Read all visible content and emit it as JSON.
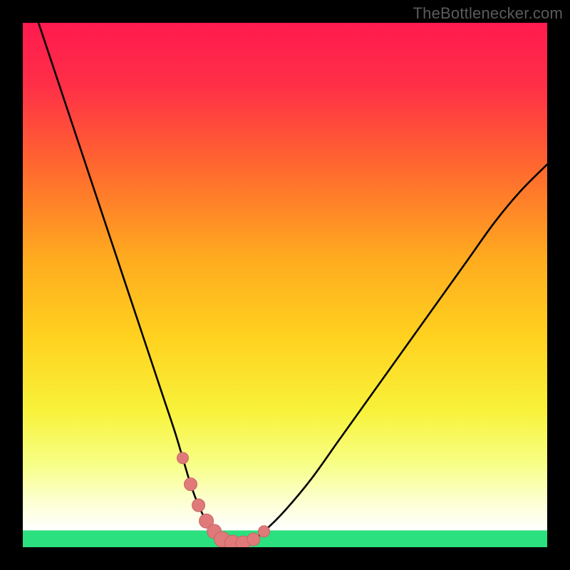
{
  "attribution": "TheBottlenecker.com",
  "colors": {
    "frame": "#000000",
    "attribution_text": "#5b5b5b",
    "curve_stroke": "#000000",
    "marker_fill": "#e07a7a",
    "marker_stroke": "#c86464",
    "green_band": "#2be07e",
    "gradient_top": "#ff1a4f",
    "gradient_mid_upper": "#ff7a2a",
    "gradient_mid": "#ffd21f",
    "gradient_mid_lower": "#f7ff55",
    "gradient_lower": "#fdffd0"
  },
  "chart_data": {
    "type": "line",
    "title": "",
    "xlabel": "",
    "ylabel": "",
    "xlim": [
      0,
      100
    ],
    "ylim": [
      0,
      100
    ],
    "grid": false,
    "series": [
      {
        "name": "bottleneck-curve",
        "x": [
          3,
          5,
          7,
          9,
          11,
          13,
          15,
          17,
          19,
          21,
          23,
          25,
          27,
          29,
          30.5,
          32,
          33.5,
          35,
          36.5,
          38,
          40,
          42,
          44,
          46,
          50,
          55,
          60,
          65,
          70,
          75,
          80,
          85,
          90,
          95,
          100
        ],
        "y": [
          100,
          94,
          88,
          82,
          76,
          70,
          64,
          58,
          52,
          46,
          40,
          34,
          28,
          22,
          17,
          12,
          8,
          5,
          3,
          1.5,
          0.8,
          0.8,
          1.5,
          3,
          7,
          13,
          20,
          27,
          34,
          41,
          48,
          55,
          62,
          68,
          73
        ]
      }
    ],
    "markers": {
      "name": "highlighted-points",
      "x": [
        30.5,
        32,
        33.5,
        35,
        36.5,
        38,
        40,
        42,
        44,
        46
      ],
      "y": [
        17,
        12,
        8,
        5,
        3,
        1.5,
        0.8,
        0.8,
        1.5,
        3,
        7
      ],
      "radius_px": [
        8,
        9,
        9,
        10,
        10,
        11,
        11,
        10,
        9,
        8
      ]
    },
    "background_bands": [
      {
        "name": "green-zone",
        "y0": 0,
        "y1": 3.2
      }
    ],
    "notes": "Values are read from pixel positions; x and y are normalized 0–100 with y=0 at the bottom of the plot. The curve is a V-shaped bottleneck profile with its minimum near x≈40."
  }
}
